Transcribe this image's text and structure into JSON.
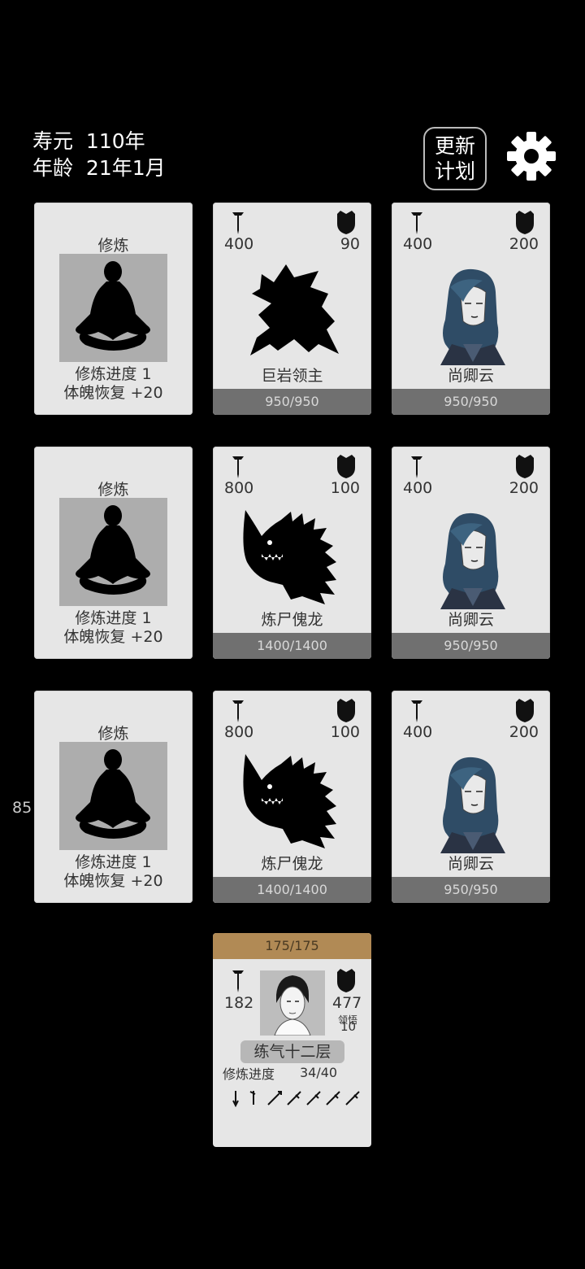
{
  "header": {
    "lifespan_label": "寿元",
    "lifespan_value": "110年",
    "age_label": "年龄",
    "age_value": "21年1月",
    "update_plan_line1": "更新",
    "update_plan_line2": "计划"
  },
  "side_number": "85",
  "rows": [
    {
      "cultivate": {
        "title": "修炼",
        "progress_label": "修炼进度",
        "progress_value": "1",
        "recover_label": "体魄恢复",
        "recover_value": "+20"
      },
      "enemy": {
        "attack": "400",
        "defense": "90",
        "name": "巨岩领主",
        "hp": "950/950",
        "art": "rock-lord"
      },
      "ally": {
        "attack": "400",
        "defense": "200",
        "name": "尚卿云",
        "hp": "950/950"
      }
    },
    {
      "cultivate": {
        "title": "修炼",
        "progress_label": "修炼进度",
        "progress_value": "1",
        "recover_label": "体魄恢复",
        "recover_value": "+20"
      },
      "enemy": {
        "attack": "800",
        "defense": "100",
        "name": "炼尸傀龙",
        "hp": "1400/1400",
        "art": "dragon"
      },
      "ally": {
        "attack": "400",
        "defense": "200",
        "name": "尚卿云",
        "hp": "950/950"
      }
    },
    {
      "cultivate": {
        "title": "修炼",
        "progress_label": "修炼进度",
        "progress_value": "1",
        "recover_label": "体魄恢复",
        "recover_value": "+20"
      },
      "enemy": {
        "attack": "800",
        "defense": "100",
        "name": "炼尸傀龙",
        "hp": "1400/1400",
        "art": "dragon"
      },
      "ally": {
        "attack": "400",
        "defense": "200",
        "name": "尚卿云",
        "hp": "950/950"
      }
    }
  ],
  "player": {
    "hp": "175/175",
    "attack": "182",
    "defense": "477",
    "insight_label": "领悟",
    "insight_value": "10",
    "realm": "练气十二层",
    "progress_label": "修炼进度",
    "progress_value": "34/40"
  },
  "icons": [
    "sword-icon",
    "shield-icon",
    "gear-icon",
    "meditation-icon"
  ]
}
